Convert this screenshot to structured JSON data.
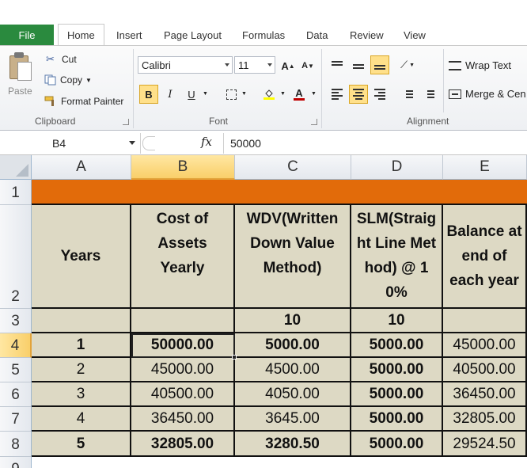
{
  "ribbon": {
    "file_tab": "File",
    "tabs": [
      "Home",
      "Insert",
      "Page Layout",
      "Formulas",
      "Data",
      "Review",
      "View"
    ],
    "clipboard": {
      "paste": "Paste",
      "cut": "Cut",
      "copy": "Copy",
      "format_painter": "Format Painter",
      "group_label": "Clipboard"
    },
    "font": {
      "name": "Calibri",
      "size": "11",
      "grow": "A",
      "shrink": "A",
      "bold": "B",
      "italic": "I",
      "underline": "U",
      "group_label": "Font"
    },
    "alignment": {
      "wrap_text": "Wrap Text",
      "merge_center": "Merge & Cen",
      "group_label": "Alignment"
    }
  },
  "formula_bar": {
    "name_box": "B4",
    "fx": "fx",
    "value": "50000"
  },
  "sheet": {
    "columns": [
      "A",
      "B",
      "C",
      "D",
      "E"
    ],
    "rows": [
      "1",
      "2",
      "3",
      "4",
      "5",
      "6",
      "7",
      "8",
      "9"
    ],
    "headers": {
      "a": "Years",
      "b": "Cost of Assets Yearly",
      "c": "WDV(Written Down Value Method)",
      "d": "SLM(Straight Line Method) @ 10%",
      "e": "Balance at end of each year"
    },
    "rates": {
      "c": "10",
      "d": "10"
    },
    "data": [
      [
        "1",
        "50000.00",
        "5000.00",
        "5000.00",
        "45000.00"
      ],
      [
        "2",
        "45000.00",
        "4500.00",
        "5000.00",
        "40500.00"
      ],
      [
        "3",
        "40500.00",
        "4050.00",
        "5000.00",
        "36450.00"
      ],
      [
        "4",
        "36450.00",
        "3645.00",
        "5000.00",
        "32805.00"
      ],
      [
        "5",
        "32805.00",
        "3280.50",
        "5000.00",
        "29524.50"
      ]
    ]
  },
  "colors": {
    "orange_band": "#e26b0a",
    "cell_fill": "#ddd9c4",
    "file_tab": "#2a8a3e"
  }
}
